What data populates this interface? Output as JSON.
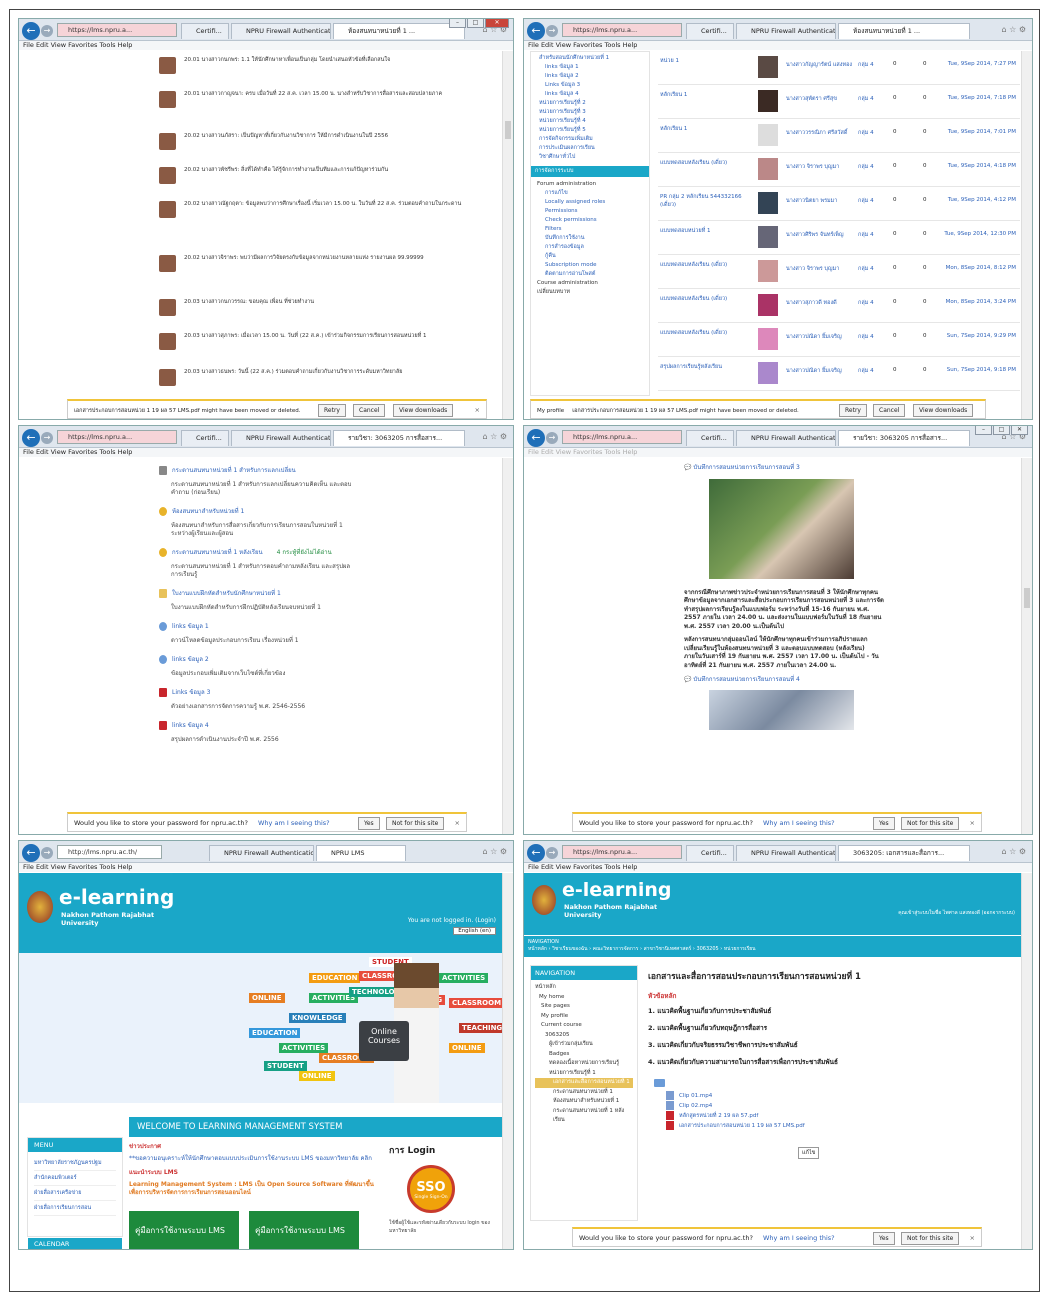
{
  "browser": {
    "menu": "File  Edit  View  Favorites  Tools  Help",
    "url_secure": "https://lms.npru.a...",
    "url_plain": "http://lms.npru.ac.th/",
    "cert_tab": "Certifi...",
    "firewall_tab": "NPRU Firewall Authentication ...",
    "lms_tab": "NPRU LMS",
    "tab_forum": "ห้องสนทนาหน่วยที่ 1 ...",
    "tab_course": "3063205 : รายวิชา...",
    "tab_course2": "รายวิชา: 3063205 การสื่อสาร...",
    "tab_course3": "3063205: เอกสารและสื่อการ..."
  },
  "win1": {
    "posts": [
      "20.01 นางสาวกนกพร: 1.1 ให้นักศึกษาหาเพื่อนเป็นกลุ่ม โดยนำเสนอหัวข้อที่เลือกสนใจ",
      "20.01 นางสาวกาญจนา: ครบ เมื่อวันที่ 22 ส.ค. เวลา 15.00 น. นางสำหรับวิชาการสื่อสารและสอบปลายภาค",
      "20.02 นางสาวนภัสรา: เป็นปัญหาที่เกี่ยวกับงานวิชาการ ให้มีการดำเนินงานในปี 2556",
      "20.02 นางสาวพัชรีพร: สิ่งที่ได้ทำคือ ได้รู้จักการทำงานเป็นทีมและการแก้ปัญหาร่วมกัน",
      "20.02 นางสาวณัฐกฤตา: ข้อมูลพบว่าการศึกษาเรื่องนี้ เริ่มเวลา 15.00 น. ในวันที่ 22 ส.ค. ร่วมตอบคำถามในกระดาน",
      "20.02 นางสาวจิราพร: พบว่ามีผลการวิจัยตรงกับข้อมูลจากหน่วยงานหลายแห่ง รายงานผล 99.99999",
      "20.03 นางสาวกนกวรรณ: ขอบคุณ เพื่อน ที่ช่วยทำงาน",
      "20.03 นางสาวสุภาพร: เมื่อเวลา 15.00 น. วันที่ (22 ส.ค.) เข้าร่วมกิจกรรมการเรียนการสอนหน่วยที่ 1",
      "20.03 นางสาวธนพร: วันนี้ (22 ส.ค.) ร่วมตอบคำถามเกี่ยวกับงานวิชาการระดับมหาวิทยาลัย",
      "20.03 นางสาวพรพิมล: สิ่งที่เป็นปัญหาในการทำงานกลุ่มได้แก่"
    ],
    "download_msg": "เอกสารประกอบการสอนหน่วย 1 19 ผล 57 LMS.pdf might have been moved or deleted.",
    "retry": "Retry",
    "cancel": "Cancel",
    "view_downloads": "View downloads"
  },
  "win2": {
    "tree": [
      "สำหรับสอนนักศึกษาหน่วยที่ 1",
      "links ข้อมูล 1",
      "links ข้อมูล 2",
      "Links ข้อมูล 3",
      "links ข้อมูล 4",
      "หน่วยการเรียนรู้ที่ 2",
      "หน่วยการเรียนรู้ที่ 3",
      "หน่วยการเรียนรู้ที่ 4",
      "หน่วยการเรียนรู้ที่ 5",
      "การจัดกิจกรรมเพิ่มเติม",
      "การประเมินผลการเรียน",
      "วิชาศึกษาทั่วไป"
    ],
    "admin_header": "การจัดการระบบ",
    "admin_items": [
      "Forum administration",
      "การแก้ไข",
      "Locally assigned roles",
      "Permissions",
      "Check permissions",
      "Filters",
      "บันทึกการใช้งาน",
      "การสำรองข้อมูล",
      "กู้คืน",
      "Subscription mode",
      "ติดตามการอ่านโพสต์",
      "Course administration",
      "เปลี่ยนบทบาท",
      "My profile"
    ],
    "rows": [
      {
        "topic": "หน่วย 1",
        "author": "นางสาวกัญญารัตน์ แสงทอง",
        "group": "กลุ่ม 4",
        "replies": "0",
        "date": "Tue, 9Sep 2014, 7:27 PM"
      },
      {
        "topic": "หลักเรียน 1",
        "author": "นางสาวสุพัตรา ศรีสุข",
        "group": "กลุ่ม 4",
        "replies": "0",
        "date": "Tue, 9Sep 2014, 7:18 PM"
      },
      {
        "topic": "หลักเรียน 1",
        "author": "นางสาววรรณิภา ศรีสวัสดิ์",
        "group": "กลุ่ม 4",
        "replies": "0",
        "date": "Tue, 9Sep 2014, 7:01 PM"
      },
      {
        "topic": "แบบทดสอบหลังเรียน (เดี่ยว)",
        "author": "นางสาว จิราพร บุญมา",
        "group": "กลุ่ม 4",
        "replies": "0",
        "date": "Tue, 9Sep 2014, 4:18 PM"
      },
      {
        "topic": "PR กลุ่ม 2 หลักเรียน 544332166 (เดี่ยว)",
        "author": "นางสาวนิตยา พรมมา",
        "group": "กลุ่ม 4",
        "replies": "0",
        "date": "Tue, 9Sep 2014, 4:12 PM"
      },
      {
        "topic": "แบบทดสอบหน่วยที่ 1",
        "author": "นางสาวศิริพร จันทร์เพ็ญ",
        "group": "กลุ่ม 4",
        "replies": "0",
        "date": "Tue, 9Sep 2014, 12:30 PM"
      },
      {
        "topic": "แบบทดสอบหลังเรียน (เดี่ยว)",
        "author": "นางสาว จิราพร บุญมา",
        "group": "กลุ่ม 4",
        "replies": "0",
        "date": "Mon, 8Sep 2014, 8:12 PM"
      },
      {
        "topic": "แบบทดสอบหลังเรียน (เดี่ยว)",
        "author": "นางสาวสุภาวดี ทองดี",
        "group": "กลุ่ม 4",
        "replies": "0",
        "date": "Mon, 8Sep 2014, 3:24 PM"
      },
      {
        "topic": "แบบทดสอบหลังเรียน (เดี่ยว)",
        "author": "นางสาวปณิดา ยิ้มเจริญ",
        "group": "กลุ่ม 4",
        "replies": "0",
        "date": "Sun, 7Sep 2014, 9:29 PM"
      },
      {
        "topic": "สรุปผลการเรียนรู้หลังเรียน",
        "author": "นางสาวปณิดา ยิ้มเจริญ",
        "group": "กลุ่ม 4",
        "replies": "0",
        "date": "Sun, 7Sep 2014, 9:18 PM"
      }
    ]
  },
  "win3": {
    "items": [
      {
        "kind": "text",
        "title": "กระดานสนทนาหน่วยที่ 1 สำหรับการแลกเปลี่ยน",
        "desc": "กระดานสนทนาหน่วยที่ 1 สำหรับการแลกเปลี่ยนความคิดเห็น และตอบคำถาม (ก่อนเรียน)"
      },
      {
        "kind": "forum",
        "title": "ห้องสนทนาสำหรับหน่วยที่ 1",
        "desc": "ห้องสนทนาสำหรับการสื่อสารเกี่ยวกับการเรียนการสอนในหน่วยที่ 1 ระหว่างผู้เรียนและผู้สอน"
      },
      {
        "kind": "forum",
        "title": "กระดานสนทนาหน่วยที่ 1 หลังเรียน",
        "badge": "4 กระทู้ที่ยังไม่ได้อ่าน",
        "desc": "กระดานสนทนาหน่วยที่ 1 สำหรับการตอบคำถามหลังเรียน และสรุปผลการเรียนรู้"
      },
      {
        "kind": "folder",
        "title": "ใบงานแบบฝึกหัดสำหรับนักศึกษาหน่วยที่ 1",
        "desc": "ใบงานแบบฝึกหัดสำหรับการฝึกปฏิบัติหลังเรียนจบหน่วยที่ 1"
      },
      {
        "kind": "url",
        "title": "links ข้อมูล 1",
        "desc": "ดาวน์โหลดข้อมูลประกอบการเรียน เรื่องหน่วยที่ 1"
      },
      {
        "kind": "url",
        "title": "links ข้อมูล 2",
        "desc": "ข้อมูลประกอบเพิ่มเติมจากเว็บไซต์ที่เกี่ยวข้อง"
      },
      {
        "kind": "pdf",
        "title": "Links ข้อมูล 3",
        "desc": "ตัวอย่างเอกสารการจัดการความรู้ พ.ศ. 2546-2556"
      },
      {
        "kind": "pdf",
        "title": "links ข้อมูล 4",
        "desc": "สรุปผลการดำเนินงานประจำปี พ.ศ. 2556"
      }
    ],
    "password_prompt": "Would you like to store your password for npru.ac.th?",
    "why": "Why am I seeing this?",
    "yes": "Yes",
    "not_for_site": "Not for this site"
  },
  "win4": {
    "heading1": "บันทึกการสอนหน่วยการเรียนการสอนที่ 3",
    "para1": "จากกรณีศึกษาภาพข่าวประจำหน่วยการเรียนการสอนที่ 3 ให้นักศึกษาทุกคนศึกษาข้อมูลจากเอกสารและสื่อประกอบการเรียนการสอนหน่วยที่ 3 และการจัดทำสรุปผลการเรียนรู้ลงในแบบฟอร์ม ระหว่างวันที่ 15-16 กันยายน พ.ศ. 2557 ภายใน เวลา 24.00 น. และส่งงานในแบบฟอร์มในวันที่ 18 กันยายน พ.ศ. 2557 เวลา 20.00 น.เป็นต้นไป",
    "para2": "หลังการสนทนากลุ่มออนไลน์ ให้นักศึกษาทุกคนเข้าร่วมการอภิปรายแลกเปลี่ยนเรียนรู้ในห้องสนทนาหน่วยที่ 3 และตอบแบบทดสอบ (หลังเรียน) ภายในวันเสาร์ที่ 19 กันยายน พ.ศ. 2557 เวลา 17.00 น. เป็นต้นไป - วันอาทิตย์ที่ 21 กันยายน พ.ศ. 2557 ภายในเวลา 24.00 น.",
    "heading2": "บันทึกการสอนหน่วยการเรียนการสอนที่ 4"
  },
  "win5": {
    "logo_title": "e-learning",
    "logo_sub1": "Nakhon Pathom Rajabhat",
    "logo_sub2": "University",
    "login_status": "You are not logged in. (Login)",
    "lang": "English (en)",
    "banner_words": [
      "STUDENT",
      "EDUCATION",
      "CLASSROOM",
      "ONLINE",
      "ACTIVITIES",
      "TECHNOLOGY",
      "TEACHING",
      "KNOWLEDGE",
      "Online Courses"
    ],
    "welcome": "WELCOME TO LEARNING MANAGEMENT SYSTEM",
    "menu_title": "MENU",
    "menu_items": [
      "มหาวิทยาลัยราชภัฏนครปฐม",
      "สำนักคอมพิวเตอร์",
      "ฝ่ายสื่อสารเครือข่าย",
      "ฝ่ายสื่อการเรียนการสอน"
    ],
    "calendar_title": "CALENDAR",
    "news_title": "ข่าวประกาศ",
    "news1": "**ขอความอนุเคราะห์ให้นักศึกษาตอบแบบประเมินการใช้งานระบบ LMS ของมหาวิทยาลัย คลิก",
    "news2_title": "แนะนำระบบ LMS",
    "news2": "Learning Management System : LMS เป็น Open Source Software ที่พัฒนาขึ้นเพื่อการบริหารจัดการการเรียนการสอนออนไลน์",
    "login_title": "การ Login",
    "sso": "SSO",
    "sso_sub": "Single Sign-On",
    "login_hint": "ใช้ชื่อผู้ใช้และรหัสผ่านเดียวกับระบบ login ของมหาวิทยาลัย",
    "manual1": "คู่มือการใช้งานระบบ LMS",
    "manual2": "คู่มือการใช้งานระบบ LMS"
  },
  "win6": {
    "user": "คุณเข้าสู่ระบบในชื่อ ไพศาล แสงทองดี (ออกจากระบบ)",
    "breadcrumb_label": "NAVIGATION",
    "breadcrumb": "หน้าหลัก  ›  วิชาเรียนของฉัน  ›  คณะวิทยาการจัดการ  ›  สาขาวิชานิเทศศาสตร์  ›  3063205  ›  หน่วยการเรียน",
    "nav_header": "NAVIGATION",
    "nav_items": [
      "หน้าหลัก",
      "My home",
      "Site pages",
      "My profile",
      "Current course",
      "3063205",
      "ผู้เข้าร่วมกลุ่มเรียน",
      "Badges",
      "ทดลองเนื้อหาหน่วยการเรียนรู้",
      "หน่วยการเรียนรู้ที่ 1",
      "เอกสารและสื่อการสอนหน่วยที่ 1",
      "กระดานสนทนาหน่วยที่ 1",
      "ห้องสนทนาสำหรับหน่วยที่ 1",
      "กระดานสนทนาหน่วยที่ 1 หลังเรียน"
    ],
    "page_title": "เอกสารและสื่อการสอนประกอบการเรียนการสอนหน่วยที่ 1",
    "subhead": "หัวข้อหลัก",
    "topics": [
      "1. แนวคิดพื้นฐานเกี่ยวกับการประชาสัมพันธ์",
      "2. แนวคิดพื้นฐานเกี่ยวกับทฤษฎีการสื่อสาร",
      "3. แนวคิดเกี่ยวกับจริยธรรมวิชาชีพการประชาสัมพันธ์",
      "4. แนวคิดเกี่ยวกับความสามารถในการสื่อสารเพื่อการประชาสัมพันธ์"
    ],
    "files": [
      "Clip 01.mp4",
      "Clip 02.mp4",
      "หลักสูตรหน่วยที่ 2 19 ผล 57.pdf",
      "เอกสารประกอบการสอนหน่วย 1 19 ผล 57 LMS.pdf"
    ],
    "edit": "แก้ไข"
  },
  "colors": {
    "teal": "#1aa7c8",
    "link": "#2a5fb8",
    "green": "#1d8a3c",
    "yellow_bar": "#f0c43a"
  }
}
